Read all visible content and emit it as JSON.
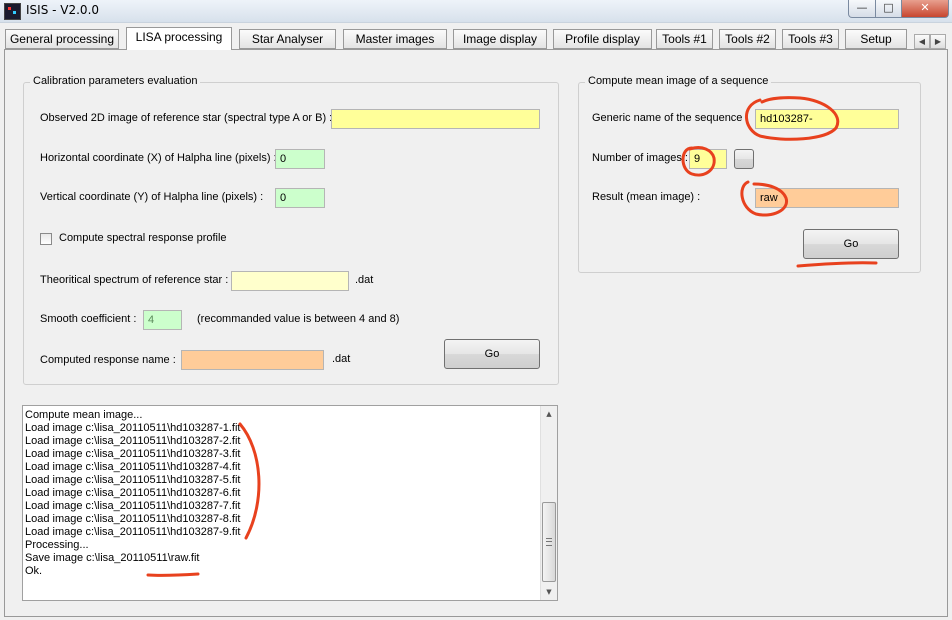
{
  "window": {
    "title": "ISIS - V2.0.0",
    "minimize_glyph": "—",
    "maximize_glyph": "□",
    "close_glyph": "✕"
  },
  "tabs": [
    {
      "label": "General processing"
    },
    {
      "label": "LISA processing",
      "active": true
    },
    {
      "label": "Star Analyser"
    },
    {
      "label": "Master images"
    },
    {
      "label": "Image display"
    },
    {
      "label": "Profile display"
    },
    {
      "label": "Tools #1"
    },
    {
      "label": "Tools #2"
    },
    {
      "label": "Tools #3"
    },
    {
      "label": "Setup"
    }
  ],
  "tab_scroll": {
    "left_glyph": "◀",
    "right_glyph": "▶"
  },
  "calibration": {
    "title": "Calibration parameters evaluation",
    "ref_image_label": "Observed 2D image of reference star (spectral type A or B) :",
    "ref_image_value": "",
    "x_coord_label": "Horizontal coordinate (X) of Halpha line (pixels) :",
    "x_coord_value": "0",
    "y_coord_label": "Vertical coordinate (Y) of Halpha line (pixels) :",
    "y_coord_value": "0",
    "spectral_response_label": "Compute spectral response profile",
    "spectral_response_checked": false,
    "theoretical_label": "Theoritical spectrum of reference star :",
    "theoretical_value": "",
    "theoretical_ext": ".dat",
    "smooth_label": "Smooth coefficient :",
    "smooth_value": "4",
    "smooth_hint": "(recommanded value is between 4 and 8)",
    "computed_label": "Computed response  name :",
    "computed_value": "",
    "computed_ext": ".dat",
    "go_label": "Go"
  },
  "mean_image": {
    "title": "Compute mean image of a sequence",
    "generic_label": "Generic name of the sequence :",
    "generic_value": "hd103287-",
    "count_label": "Number of images :",
    "count_value": "9",
    "result_label": "Result (mean image) :",
    "result_value": "raw",
    "go_label": "Go"
  },
  "log": {
    "lines": [
      "Compute mean image...",
      "Load image c:\\lisa_20110511\\hd103287-1.fit",
      "Load image c:\\lisa_20110511\\hd103287-2.fit",
      "Load image c:\\lisa_20110511\\hd103287-3.fit",
      "Load image c:\\lisa_20110511\\hd103287-4.fit",
      "Load image c:\\lisa_20110511\\hd103287-5.fit",
      "Load image c:\\lisa_20110511\\hd103287-6.fit",
      "Load image c:\\lisa_20110511\\hd103287-7.fit",
      "Load image c:\\lisa_20110511\\hd103287-8.fit",
      "Load image c:\\lisa_20110511\\hd103287-9.fit",
      "Processing...",
      "Save image c:\\lisa_20110511\\raw.fit",
      "Ok."
    ],
    "scroll_up_glyph": "▲",
    "scroll_down_glyph": "▼"
  },
  "colors": {
    "annotation": "#e8411e",
    "yellow_field": "#ffff99",
    "green_field": "#ccffcc",
    "orange_field": "#ffcc99"
  }
}
